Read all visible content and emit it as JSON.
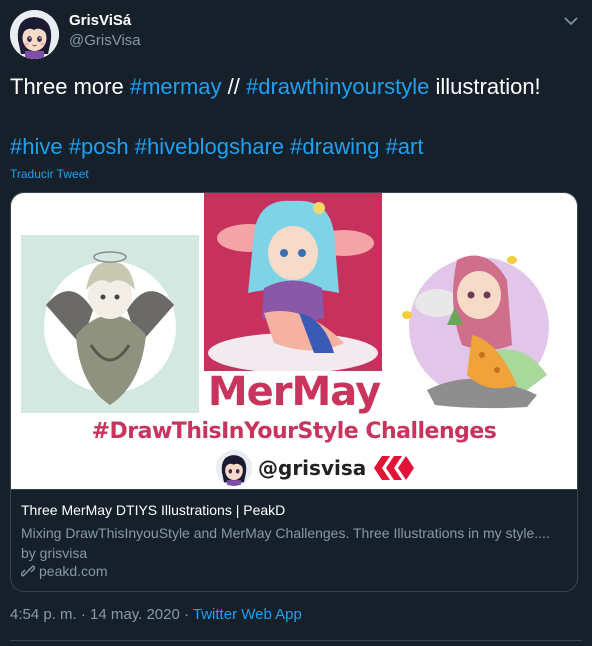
{
  "user": {
    "display_name": "GrisViSá",
    "handle": "@GrisVisa",
    "avatar_icon": "girl-avatar-icon"
  },
  "tweet": {
    "text_prefix": "Three more ",
    "tag_mermay": "#mermay",
    "text_sep": " // ",
    "tag_dtiys": "#drawthinyourstyle",
    "text_suffix": " illustration!",
    "tags": [
      "#hive",
      "#posh",
      "#hiveblogshare",
      "#drawing",
      "#art"
    ],
    "translate_label": "Traducir Tweet"
  },
  "card": {
    "image_title": "MerMay",
    "image_subtitle": "#DrawThisInYourStyle Challenges",
    "image_handle": "@grisvisa",
    "title": "Three MerMay DTIYS Illustrations | PeakD",
    "description": "Mixing DrawThisInyouStyle and MerMay Challenges. Three Illustrations in my style.... by grisvisa",
    "domain": "peakd.com",
    "link_icon": "link-icon"
  },
  "meta": {
    "time": "4:54 p. m.",
    "sep": " · ",
    "date": "14 may. 2020",
    "source": "Twitter Web App"
  },
  "colors": {
    "background": "#15202b",
    "link": "#1da1f2",
    "secondary_text": "#8899a6",
    "border": "#38444d",
    "mermay_pink": "#c8345b",
    "hive_red": "#e31337"
  }
}
